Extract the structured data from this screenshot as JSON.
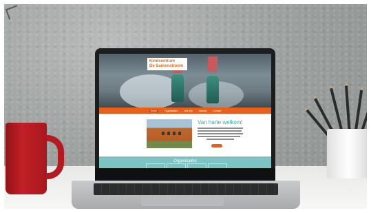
{
  "website": {
    "logo": {
      "line1": "Kindcentrum",
      "line2": "De Samenstroom"
    },
    "nav": [
      "Home",
      "Organisaties",
      "Wie zijn",
      "Nieuws",
      "Contact"
    ],
    "welcome_heading": "Van harte welkom!",
    "section_title": "Organisaties"
  },
  "colors": {
    "brand_orange": "#e8601c",
    "teal": "#7dc3c3",
    "heading_teal": "#3aa6a6",
    "mug_red": "#c21f26"
  },
  "objects": {
    "left": "red-mug",
    "center": "laptop",
    "right": "pencil-cup"
  }
}
